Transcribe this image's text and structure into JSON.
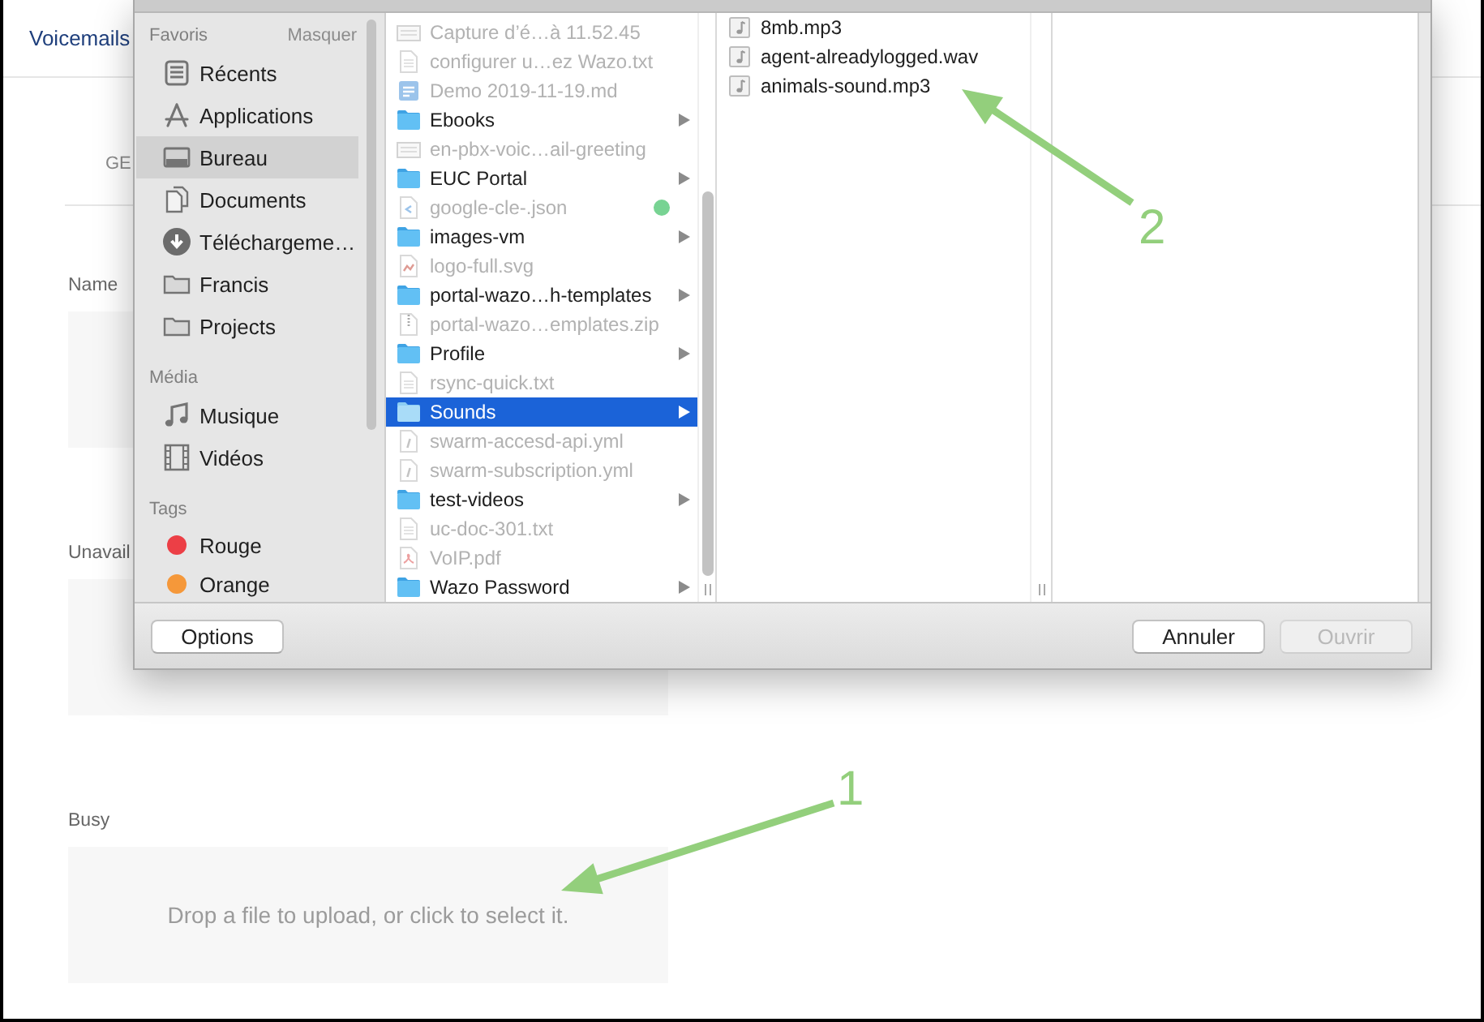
{
  "page": {
    "title": "Voicemails",
    "tabs": [
      {
        "label": "GE"
      }
    ],
    "fields": [
      {
        "label": "Name"
      },
      {
        "label": "Unavail"
      },
      {
        "label": "Busy",
        "placeholder": "Drop a file to upload, or click to select it."
      }
    ]
  },
  "dialog": {
    "sidebar": [
      {
        "title": "Favoris",
        "action": "Masquer",
        "items": [
          {
            "label": "Récents",
            "kind": "recents",
            "selected": false
          },
          {
            "label": "Applications",
            "kind": "applications",
            "selected": false
          },
          {
            "label": "Bureau",
            "kind": "desktop",
            "selected": true
          },
          {
            "label": "Documents",
            "kind": "documents",
            "selected": false
          },
          {
            "label": "Téléchargeme…",
            "kind": "downloads",
            "selected": false
          },
          {
            "label": "Francis",
            "kind": "folder",
            "selected": false
          },
          {
            "label": "Projects",
            "kind": "folder",
            "selected": false
          }
        ]
      },
      {
        "title": "Média",
        "items": [
          {
            "label": "Musique",
            "kind": "music",
            "selected": false
          },
          {
            "label": "Vidéos",
            "kind": "video",
            "selected": false
          }
        ]
      },
      {
        "title": "Tags",
        "items": [
          {
            "label": "Rouge",
            "kind": "tag",
            "color": "#ec3f46",
            "selected": false
          },
          {
            "label": "Orange",
            "kind": "tag",
            "color": "#f5983a",
            "selected": false
          }
        ]
      }
    ],
    "columns": [
      {
        "items": [
          {
            "name": "Capture d’é…à 11.52.45",
            "kind": "image",
            "disabled": true,
            "selected": false
          },
          {
            "name": "configurer u…ez Wazo.txt",
            "kind": "text",
            "disabled": true,
            "selected": false
          },
          {
            "name": "Demo 2019-11-19.md",
            "kind": "markdown",
            "disabled": true,
            "selected": false
          },
          {
            "name": "Ebooks",
            "kind": "folder",
            "disabled": false,
            "selected": false
          },
          {
            "name": "en-pbx-voic…ail-greeting",
            "kind": "image",
            "disabled": true,
            "selected": false
          },
          {
            "name": "EUC Portal",
            "kind": "folder",
            "disabled": false,
            "selected": false
          },
          {
            "name": "google-cle-.json",
            "kind": "code",
            "disabled": true,
            "selected": false,
            "color": "#78d393"
          },
          {
            "name": "images-vm",
            "kind": "folder",
            "disabled": false,
            "selected": false
          },
          {
            "name": "logo-full.svg",
            "kind": "vector",
            "disabled": true,
            "selected": false
          },
          {
            "name": "portal-wazo…h-templates",
            "kind": "folder",
            "disabled": false,
            "selected": false
          },
          {
            "name": "portal-wazo…emplates.zip",
            "kind": "archive",
            "disabled": true,
            "selected": false
          },
          {
            "name": "Profile",
            "kind": "folder",
            "disabled": false,
            "selected": false
          },
          {
            "name": "rsync-quick.txt",
            "kind": "text",
            "disabled": true,
            "selected": false
          },
          {
            "name": "Sounds",
            "kind": "folder",
            "disabled": false,
            "selected": true
          },
          {
            "name": "swarm-accesd-api.yml",
            "kind": "script",
            "disabled": true,
            "selected": false
          },
          {
            "name": "swarm-subscription.yml",
            "kind": "script",
            "disabled": true,
            "selected": false
          },
          {
            "name": "test-videos",
            "kind": "folder",
            "disabled": false,
            "selected": false
          },
          {
            "name": "uc-doc-301.txt",
            "kind": "text",
            "disabled": true,
            "selected": false
          },
          {
            "name": "VoIP.pdf",
            "kind": "pdf",
            "disabled": true,
            "selected": false
          },
          {
            "name": "Wazo Password",
            "kind": "folder",
            "disabled": false,
            "selected": false
          }
        ]
      },
      {
        "items": [
          {
            "name": "8mb.mp3",
            "kind": "audio",
            "disabled": false,
            "selected": false
          },
          {
            "name": "agent-alreadylogged.wav",
            "kind": "audio",
            "disabled": false,
            "selected": false
          },
          {
            "name": "animals-sound.mp3",
            "kind": "audio",
            "disabled": false,
            "selected": false
          }
        ]
      }
    ],
    "footer": {
      "left_buttons": [
        {
          "label": "Options",
          "disabled": false
        }
      ],
      "right_buttons": [
        {
          "label": "Annuler",
          "disabled": false
        },
        {
          "label": "Ouvrir",
          "disabled": true
        }
      ]
    }
  },
  "annotations": [
    {
      "label": "1"
    },
    {
      "label": "2"
    }
  ]
}
